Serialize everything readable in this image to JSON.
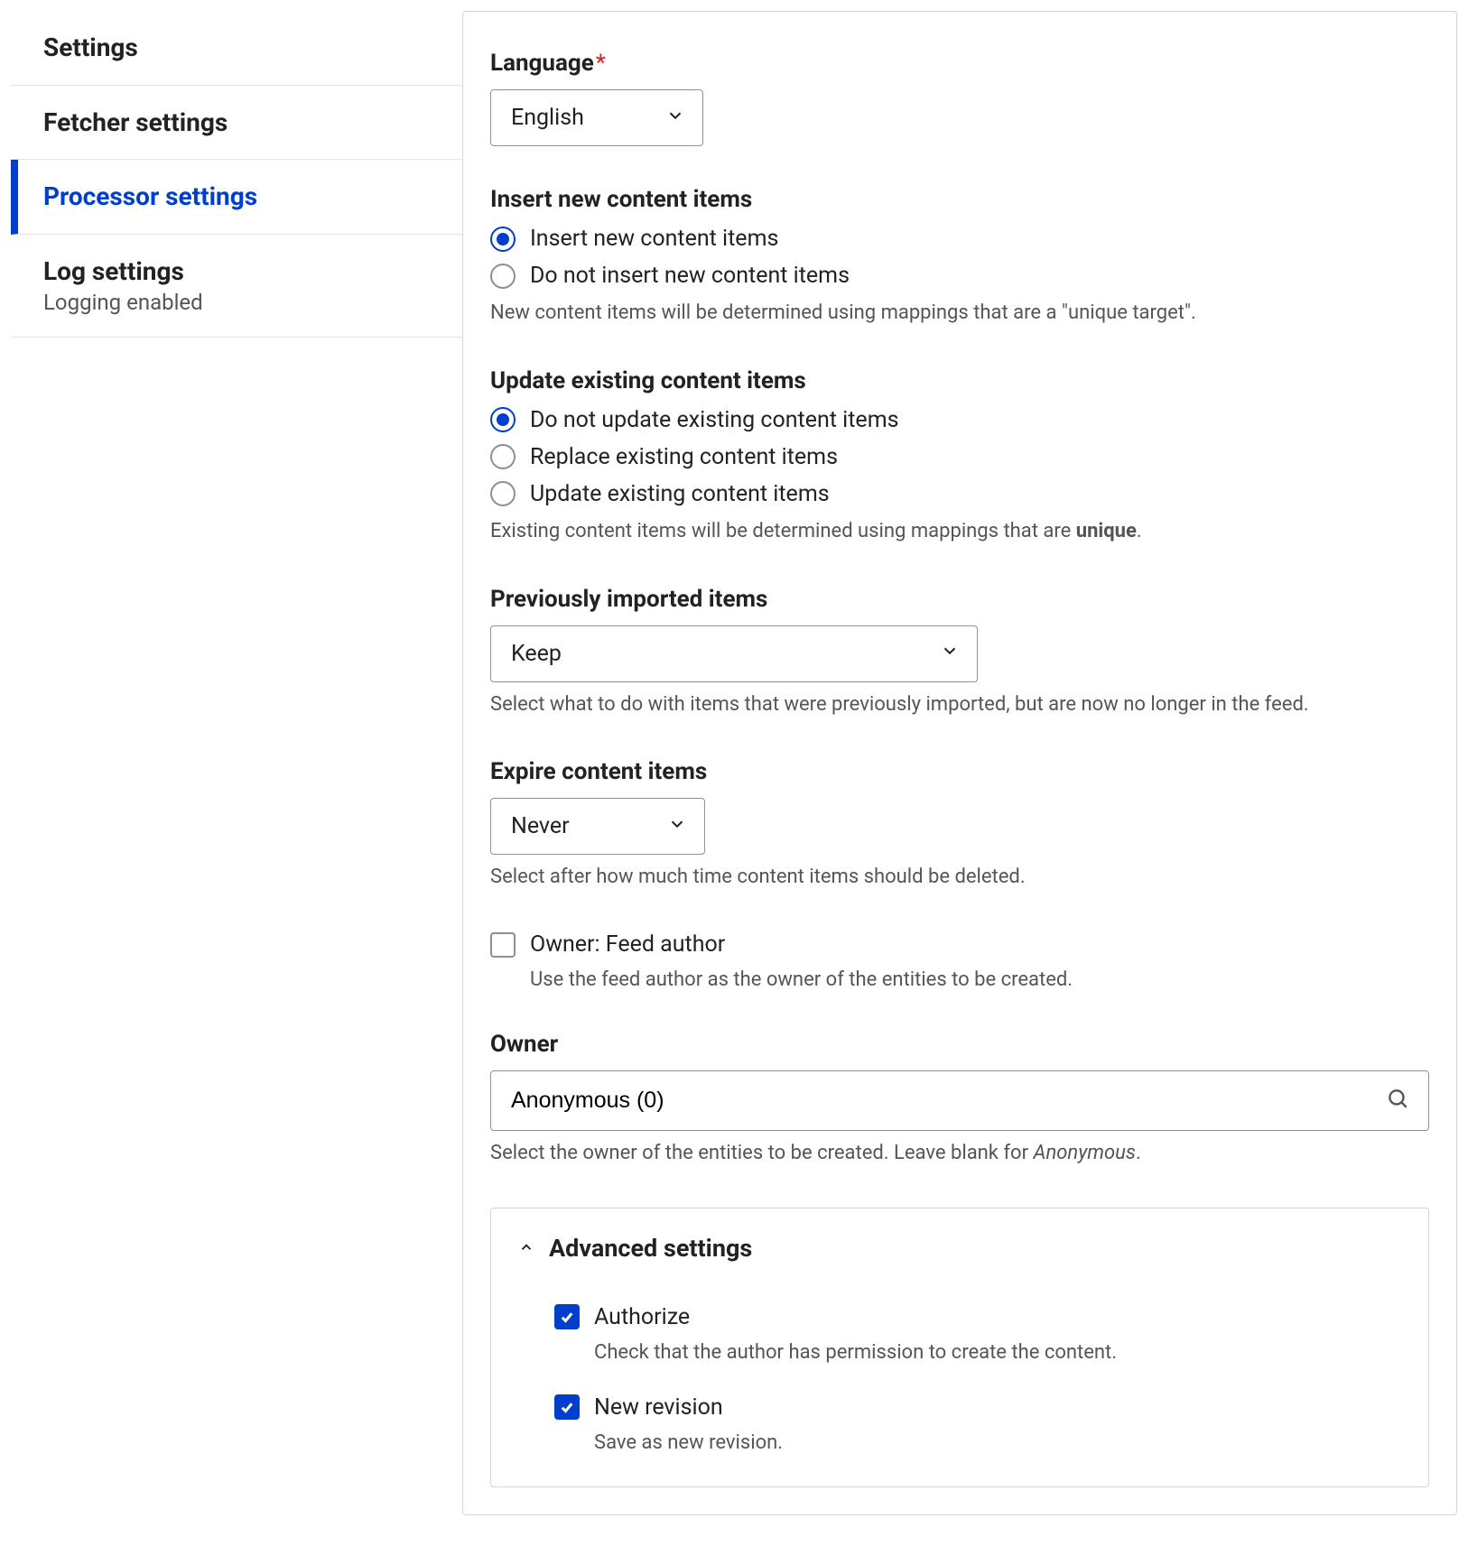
{
  "sidebar": {
    "items": [
      {
        "label": "Settings",
        "sub": ""
      },
      {
        "label": "Fetcher settings",
        "sub": ""
      },
      {
        "label": "Processor settings",
        "sub": ""
      },
      {
        "label": "Log settings",
        "sub": "Logging enabled"
      }
    ]
  },
  "form": {
    "language": {
      "label": "Language",
      "value": "English"
    },
    "insert": {
      "legend": "Insert new content items",
      "options": [
        "Insert new content items",
        "Do not insert new content items"
      ],
      "selected": 0,
      "help": "New content items will be determined using mappings that are a \"unique target\"."
    },
    "update": {
      "legend": "Update existing content items",
      "options": [
        "Do not update existing content items",
        "Replace existing content items",
        "Update existing content items"
      ],
      "selected": 0,
      "help_prefix": "Existing content items will be determined using mappings that are ",
      "help_bold": "unique",
      "help_suffix": "."
    },
    "prev_imported": {
      "label": "Previously imported items",
      "value": "Keep",
      "help": "Select what to do with items that were previously imported, but are now no longer in the feed."
    },
    "expire": {
      "label": "Expire content items",
      "value": "Never",
      "help": "Select after how much time content items should be deleted."
    },
    "owner_feed_author": {
      "label": "Owner: Feed author",
      "help": "Use the feed author as the owner of the entities to be created.",
      "checked": false
    },
    "owner": {
      "label": "Owner",
      "value": "Anonymous (0)",
      "help_prefix": "Select the owner of the entities to be created. Leave blank for ",
      "help_italic": "Anonymous",
      "help_suffix": "."
    },
    "advanced": {
      "title": "Advanced settings",
      "authorize": {
        "label": "Authorize",
        "help": "Check that the author has permission to create the content.",
        "checked": true
      },
      "revision": {
        "label": "New revision",
        "help": "Save as new revision.",
        "checked": true
      }
    }
  }
}
